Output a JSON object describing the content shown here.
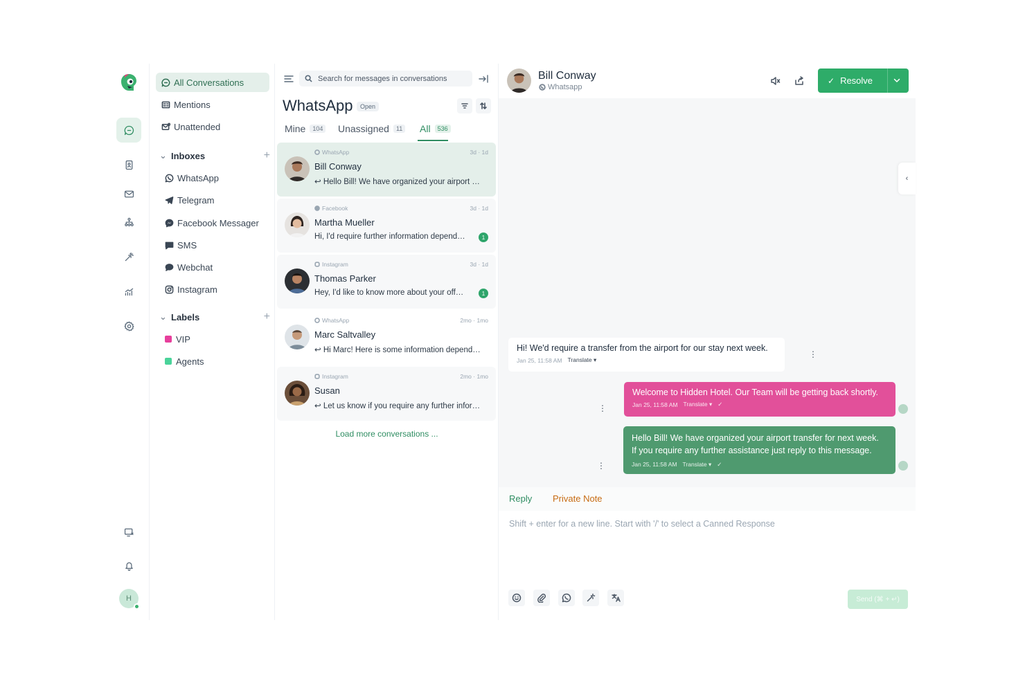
{
  "sidebar": {
    "all_conversations": "All Conversations",
    "mentions": "Mentions",
    "unattended": "Unattended",
    "inboxes_heading": "Inboxes",
    "inboxes": [
      {
        "label": "WhatsApp",
        "icon": "whatsapp-icon"
      },
      {
        "label": "Telegram",
        "icon": "telegram-icon"
      },
      {
        "label": "Facebook Messager",
        "icon": "messenger-icon"
      },
      {
        "label": "SMS",
        "icon": "sms-icon"
      },
      {
        "label": "Webchat",
        "icon": "webchat-icon"
      },
      {
        "label": "Instagram",
        "icon": "instagram-icon"
      }
    ],
    "labels_heading": "Labels",
    "labels": [
      {
        "label": "VIP",
        "color": "#e73f9c"
      },
      {
        "label": "Agents",
        "color": "#4ad39a"
      }
    ]
  },
  "rail": {
    "avatar_initial": "H",
    "status_color": "#3bb16f"
  },
  "list": {
    "search_placeholder": "Search for messages in conversations",
    "title": "WhatsApp",
    "status_badge": "Open",
    "tabs": [
      {
        "label": "Mine",
        "count": "104"
      },
      {
        "label": "Unassigned",
        "count": "11"
      },
      {
        "label": "All",
        "count": "536"
      }
    ],
    "conversations": [
      {
        "source": "WhatsApp",
        "time": "3d · 1d",
        "name": "Bill Conway",
        "message": "Hello Bill! We have organized your airport transfer for next week.",
        "unread": ""
      },
      {
        "source": "Facebook",
        "time": "3d · 1d",
        "name": "Martha Mueller",
        "message": "Hi, I'd require further information depending on the offer",
        "unread": "1"
      },
      {
        "source": "Instagram",
        "time": "3d · 1d",
        "name": "Thomas Parker",
        "message": "Hey, I'd like to know more about your offers",
        "unread": "1"
      },
      {
        "source": "WhatsApp",
        "time": "2mo · 1mo",
        "name": "Marc Saltvalley",
        "message": "Hi Marc! Here is some information depending on your request",
        "unread": ""
      },
      {
        "source": "Instagram",
        "time": "2mo · 1mo",
        "name": "Susan",
        "message": "Let us know if you require any further information",
        "unread": ""
      }
    ],
    "load_more": "Load more conversations ..."
  },
  "chat": {
    "contact_name": "Bill Conway",
    "contact_channel": "Whatsapp",
    "resolve_label": "Resolve",
    "messages": [
      {
        "text": "Hi! We'd require a transfer from the airport for our stay next week.",
        "time": "Jan 25, 11:58 AM",
        "translate": "Translate"
      },
      {
        "text": "Welcome to Hidden Hotel. Our Team will be getting back shortly.",
        "time": "Jan 25, 11:58 AM",
        "translate": "Translate"
      },
      {
        "text": "Hello Bill! We have organized your airport transfer for next week.",
        "text2": "If you require any further assistance just reply to this message.",
        "time": "Jan 25, 11:58 AM",
        "translate": "Translate"
      }
    ],
    "reply_tab": "Reply",
    "note_tab": "Private Note",
    "composer_placeholder": "Shift + enter for a new line. Start with '/' to select a Canned Response",
    "send_label": "Send (⌘ + ↵)"
  },
  "colors": {
    "brand_green": "#2eac69",
    "pink_bubble": "#e2509a",
    "green_bubble": "#4f9a6f",
    "private_note": "#c76b12"
  }
}
